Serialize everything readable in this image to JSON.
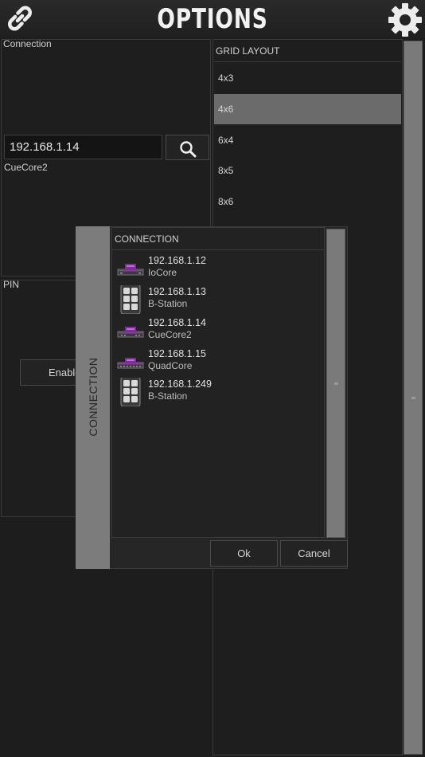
{
  "header": {
    "title": "OPTIONS",
    "left_icon": "link-icon",
    "right_icon": "gear-icon"
  },
  "connection_panel": {
    "label": "Connection",
    "ip_value": "192.168.1.14",
    "device_name": "CueCore2",
    "search_icon": "search-icon"
  },
  "pin_panel": {
    "label": "PIN",
    "enable_label": "Enable"
  },
  "grid_layout": {
    "header": "GRID LAYOUT",
    "items": [
      "4x3",
      "4x6",
      "6x4",
      "8x5",
      "8x6"
    ],
    "selected": "4x6"
  },
  "dialog": {
    "side_label": "CONNECTION",
    "list_header": "CONNECTION",
    "devices": [
      {
        "ip": "192.168.1.12",
        "type": "IoCore",
        "icon": "rack-device-icon"
      },
      {
        "ip": "192.168.1.13",
        "type": "B-Station",
        "icon": "b-station-icon"
      },
      {
        "ip": "192.168.1.14",
        "type": "CueCore2",
        "icon": "rack-device-icon"
      },
      {
        "ip": "192.168.1.15",
        "type": "QuadCore",
        "icon": "rack-device-icon"
      },
      {
        "ip": "192.168.1.249",
        "type": "B-Station",
        "icon": "b-station-icon"
      }
    ],
    "ok_label": "Ok",
    "cancel_label": "Cancel"
  },
  "colors": {
    "background": "#1d1d1d",
    "selected_row": "#6b6b6b",
    "device_accent": "#9b3fb5"
  }
}
